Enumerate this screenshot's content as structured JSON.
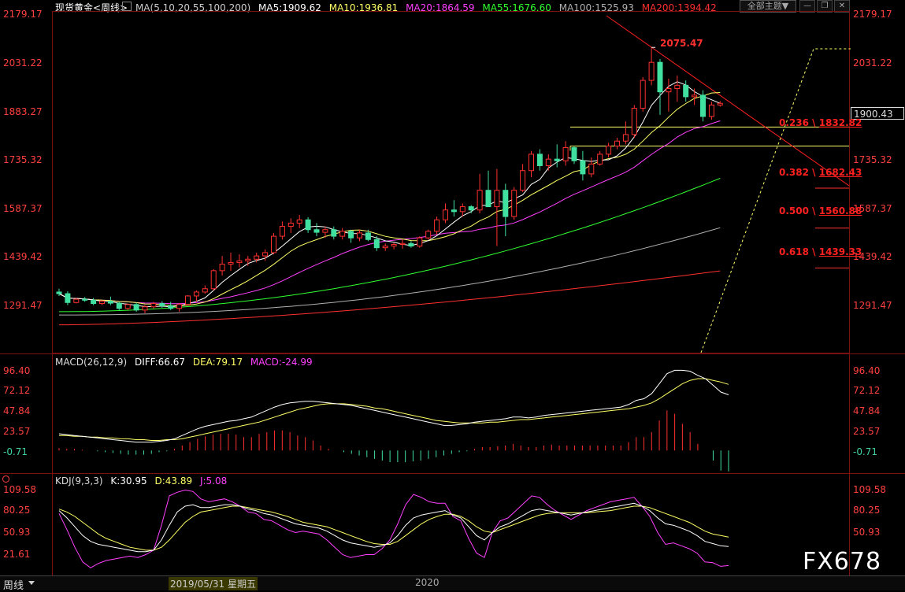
{
  "main_header": {
    "symbol": "现货黄金<周线>",
    "ma_params": "MA(5,10,20,55,100,200)",
    "ma5": "MA5:1909.62",
    "ma10": "MA10:1936.81",
    "ma20": "MA20:1864.59",
    "ma55": "MA55:1676.60",
    "ma100": "MA100:1525.93",
    "ma200": "MA200:1394.42"
  },
  "toolbar": {
    "theme_label": "全部主题▼",
    "minimize": "—",
    "restore": "❐",
    "close": "✕"
  },
  "price_axis": [
    "2179.17",
    "2031.22",
    "1883.27",
    "1735.32",
    "1587.37",
    "1439.42",
    "1291.47"
  ],
  "current_price": "1900.43",
  "peak_label": "2075.47",
  "fib_levels": [
    {
      "ratio": "0.236",
      "price": "1832.82"
    },
    {
      "ratio": "0.382",
      "price": "1682.43"
    },
    {
      "ratio": "0.500",
      "price": "1560.88"
    },
    {
      "ratio": "0.618",
      "price": "1439.33"
    }
  ],
  "macd_header": {
    "name": "MACD(26,12,9)",
    "diff": "DIFF:66.67",
    "dea": "DEA:79.17",
    "macd": "MACD:-24.99"
  },
  "macd_axis": [
    "96.40",
    "72.12",
    "47.84",
    "23.57",
    "-0.71"
  ],
  "kdj_header": {
    "name": "KDJ(9,3,3)",
    "k": "K:30.95",
    "d": "D:43.89",
    "j": "J:5.08"
  },
  "kdj_axis": [
    "109.58",
    "80.25",
    "50.93",
    "21.61"
  ],
  "bottom": {
    "period_tab": "周线",
    "date_highlight": "2019/05/31 星期五",
    "year_label": "2020"
  },
  "watermark": "FX678",
  "colors": {
    "up": "#ff3030",
    "down": "#40e0a0",
    "ma5": "#ffffff",
    "ma10": "#ffff66",
    "ma20": "#ff40ff",
    "ma55": "#30ff30",
    "ma100": "#b0b0b0",
    "ma200": "#ff3030",
    "axis_red": "#ff4040"
  },
  "chart_data": [
    {
      "type": "candlestick",
      "title": "现货黄金<周线>",
      "ylim": [
        1200,
        2200
      ],
      "candles": [
        [
          1330,
          1340,
          1318,
          1325
        ],
        [
          1325,
          1332,
          1290,
          1298
        ],
        [
          1298,
          1312,
          1295,
          1308
        ],
        [
          1308,
          1315,
          1300,
          1305
        ],
        [
          1305,
          1312,
          1290,
          1295
        ],
        [
          1295,
          1305,
          1290,
          1302
        ],
        [
          1302,
          1316,
          1290,
          1296
        ],
        [
          1296,
          1300,
          1275,
          1280
        ],
        [
          1280,
          1295,
          1275,
          1292
        ],
        [
          1292,
          1298,
          1270,
          1275
        ],
        [
          1275,
          1290,
          1265,
          1285
        ],
        [
          1285,
          1300,
          1280,
          1295
        ],
        [
          1295,
          1302,
          1282,
          1288
        ],
        [
          1288,
          1300,
          1275,
          1280
        ],
        [
          1280,
          1296,
          1270,
          1292
        ],
        [
          1292,
          1320,
          1290,
          1318
        ],
        [
          1318,
          1335,
          1300,
          1330
        ],
        [
          1330,
          1350,
          1325,
          1340
        ],
        [
          1340,
          1400,
          1335,
          1395
        ],
        [
          1395,
          1440,
          1380,
          1415
        ],
        [
          1415,
          1450,
          1395,
          1420
        ],
        [
          1420,
          1445,
          1405,
          1425
        ],
        [
          1425,
          1440,
          1410,
          1430
        ],
        [
          1430,
          1450,
          1420,
          1440
        ],
        [
          1440,
          1460,
          1425,
          1450
        ],
        [
          1450,
          1510,
          1445,
          1500
        ],
        [
          1500,
          1545,
          1490,
          1530
        ],
        [
          1530,
          1555,
          1510,
          1540
        ],
        [
          1540,
          1565,
          1525,
          1550
        ],
        [
          1550,
          1558,
          1510,
          1520
        ],
        [
          1520,
          1540,
          1500,
          1512
        ],
        [
          1512,
          1530,
          1495,
          1520
        ],
        [
          1520,
          1530,
          1490,
          1500
        ],
        [
          1500,
          1525,
          1490,
          1515
        ],
        [
          1515,
          1520,
          1480,
          1495
        ],
        [
          1495,
          1520,
          1485,
          1510
        ],
        [
          1510,
          1520,
          1485,
          1490
        ],
        [
          1490,
          1500,
          1455,
          1465
        ],
        [
          1465,
          1478,
          1455,
          1470
        ],
        [
          1470,
          1480,
          1460,
          1475
        ],
        [
          1475,
          1490,
          1462,
          1478
        ],
        [
          1478,
          1485,
          1465,
          1470
        ],
        [
          1470,
          1500,
          1465,
          1495
        ],
        [
          1495,
          1520,
          1490,
          1515
        ],
        [
          1515,
          1560,
          1505,
          1550
        ],
        [
          1550,
          1600,
          1540,
          1580
        ],
        [
          1580,
          1610,
          1560,
          1575
        ],
        [
          1575,
          1600,
          1560,
          1590
        ],
        [
          1590,
          1595,
          1570,
          1580
        ],
        [
          1580,
          1690,
          1570,
          1640
        ],
        [
          1640,
          1700,
          1590,
          1590
        ],
        [
          1590,
          1705,
          1470,
          1640
        ],
        [
          1640,
          1660,
          1500,
          1560
        ],
        [
          1560,
          1650,
          1550,
          1640
        ],
        [
          1640,
          1720,
          1635,
          1700
        ],
        [
          1700,
          1760,
          1680,
          1750
        ],
        [
          1750,
          1765,
          1700,
          1715
        ],
        [
          1715,
          1750,
          1700,
          1735
        ],
        [
          1735,
          1780,
          1710,
          1730
        ],
        [
          1730,
          1790,
          1715,
          1770
        ],
        [
          1770,
          1775,
          1720,
          1730
        ],
        [
          1730,
          1760,
          1670,
          1690
        ],
        [
          1690,
          1740,
          1680,
          1720
        ],
        [
          1720,
          1760,
          1715,
          1750
        ],
        [
          1750,
          1785,
          1740,
          1775
        ],
        [
          1775,
          1800,
          1765,
          1790
        ],
        [
          1790,
          1850,
          1780,
          1810
        ],
        [
          1810,
          1900,
          1800,
          1890
        ],
        [
          1890,
          1985,
          1880,
          1975
        ],
        [
          1975,
          2075,
          1960,
          2030
        ],
        [
          2030,
          2040,
          1870,
          1940
        ],
        [
          1940,
          1980,
          1880,
          1950
        ],
        [
          1950,
          1990,
          1910,
          1960
        ],
        [
          1960,
          1975,
          1910,
          1925
        ],
        [
          1925,
          1950,
          1900,
          1930
        ],
        [
          1930,
          1945,
          1850,
          1865
        ],
        [
          1865,
          1910,
          1855,
          1900
        ],
        [
          1900,
          1912,
          1895,
          1905
        ]
      ],
      "annotations": {
        "peak": 2075.47,
        "current": 1900.43
      }
    },
    {
      "type": "line",
      "title": "MACD(26,12,9)",
      "ylim": [
        -10,
        100
      ],
      "series": [
        {
          "name": "DIFF",
          "values": [
            20,
            19,
            18,
            17,
            16,
            15,
            14,
            13,
            12,
            11,
            10,
            10,
            10,
            11,
            12,
            14,
            18,
            22,
            26,
            29,
            31,
            33,
            35,
            36,
            38,
            40,
            44,
            48,
            52,
            55,
            57,
            58,
            59,
            59,
            58,
            57,
            56,
            55,
            54,
            52,
            50,
            48,
            46,
            44,
            42,
            40,
            38,
            36,
            34,
            32,
            30,
            30,
            31,
            32,
            34,
            35,
            36,
            37,
            38,
            40,
            40,
            39,
            40,
            42,
            43,
            44,
            45,
            46,
            47,
            48,
            49,
            50,
            51,
            52,
            55,
            60,
            62,
            68,
            80,
            92,
            96,
            96,
            95,
            90,
            86,
            78,
            70,
            66.67
          ]
        },
        {
          "name": "DEA",
          "values": [
            18,
            18,
            17,
            17,
            16,
            16,
            15,
            15,
            14,
            14,
            13,
            13,
            12,
            12,
            13,
            13,
            14,
            16,
            18,
            20,
            22,
            24,
            26,
            28,
            30,
            32,
            34,
            37,
            40,
            43,
            46,
            49,
            51,
            53,
            55,
            56,
            56,
            56,
            55,
            54,
            53,
            51,
            50,
            48,
            46,
            44,
            42,
            40,
            38,
            36,
            35,
            34,
            33,
            33,
            33,
            33,
            34,
            34,
            35,
            36,
            37,
            37,
            38,
            39,
            40,
            41,
            42,
            43,
            44,
            45,
            46,
            47,
            48,
            49,
            50,
            52,
            54,
            57,
            62,
            68,
            74,
            80,
            84,
            86,
            86,
            84,
            82,
            79.17
          ]
        },
        {
          "name": "MACD",
          "values": [
            3,
            2,
            2,
            1,
            0,
            -1,
            -2,
            -3,
            -4,
            -5,
            -5,
            -5,
            -4,
            -2,
            -1,
            2,
            6,
            10,
            14,
            17,
            19,
            20,
            20,
            19,
            16,
            16,
            20,
            22,
            24,
            24,
            22,
            18,
            16,
            12,
            6,
            2,
            0,
            -2,
            -4,
            -6,
            -8,
            -10,
            -12,
            -14,
            -14,
            -14,
            -13,
            -12,
            -10,
            -8,
            -6,
            -4,
            -2,
            -1,
            2,
            4,
            4,
            5,
            6,
            8,
            6,
            4,
            4,
            6,
            7,
            6,
            6,
            6,
            6,
            6,
            6,
            6,
            6,
            6,
            10,
            16,
            16,
            22,
            36,
            48,
            44,
            32,
            22,
            8,
            0,
            -12,
            -24,
            -24.99
          ]
        }
      ]
    },
    {
      "type": "line",
      "title": "KDJ(9,3,3)",
      "ylim": [
        0,
        115
      ],
      "series": [
        {
          "name": "K",
          "values": [
            80,
            70,
            58,
            46,
            38,
            34,
            32,
            30,
            28,
            26,
            24,
            24,
            26,
            40,
            60,
            78,
            86,
            88,
            84,
            84,
            86,
            88,
            88,
            86,
            82,
            80,
            76,
            74,
            70,
            66,
            62,
            60,
            58,
            56,
            52,
            46,
            40,
            36,
            34,
            32,
            30,
            32,
            36,
            46,
            60,
            70,
            74,
            76,
            78,
            80,
            74,
            70,
            58,
            46,
            40,
            50,
            58,
            62,
            68,
            74,
            80,
            82,
            80,
            78,
            76,
            74,
            76,
            78,
            80,
            82,
            84,
            86,
            88,
            90,
            86,
            80,
            70,
            62,
            60,
            56,
            52,
            46,
            38,
            35,
            32,
            30.95
          ]
        },
        {
          "name": "D",
          "values": [
            82,
            78,
            72,
            64,
            56,
            48,
            42,
            38,
            34,
            30,
            28,
            26,
            26,
            30,
            40,
            52,
            64,
            72,
            78,
            80,
            82,
            84,
            86,
            86,
            84,
            82,
            80,
            78,
            75,
            72,
            68,
            64,
            62,
            60,
            58,
            54,
            50,
            46,
            42,
            38,
            35,
            34,
            34,
            38,
            46,
            54,
            62,
            68,
            72,
            75,
            75,
            72,
            66,
            58,
            52,
            50,
            54,
            58,
            62,
            66,
            70,
            74,
            76,
            77,
            77,
            77,
            77,
            77,
            78,
            79,
            80,
            82,
            84,
            86,
            86,
            84,
            80,
            76,
            72,
            68,
            64,
            58,
            52,
            48,
            46,
            43.89
          ]
        },
        {
          "name": "J",
          "values": [
            76,
            54,
            30,
            10,
            2,
            8,
            12,
            14,
            16,
            18,
            16,
            20,
            26,
            60,
            100,
            105,
            108,
            106,
            96,
            92,
            94,
            96,
            92,
            86,
            78,
            76,
            68,
            66,
            60,
            54,
            50,
            52,
            50,
            48,
            40,
            30,
            20,
            16,
            18,
            20,
            20,
            28,
            40,
            62,
            88,
            102,
            98,
            92,
            90,
            90,
            72,
            66,
            42,
            22,
            16,
            50,
            66,
            70,
            80,
            90,
            100,
            98,
            88,
            80,
            74,
            68,
            74,
            80,
            84,
            88,
            92,
            94,
            96,
            98,
            86,
            72,
            50,
            34,
            36,
            32,
            28,
            22,
            10,
            9,
            4,
            5.08
          ]
        }
      ]
    }
  ]
}
